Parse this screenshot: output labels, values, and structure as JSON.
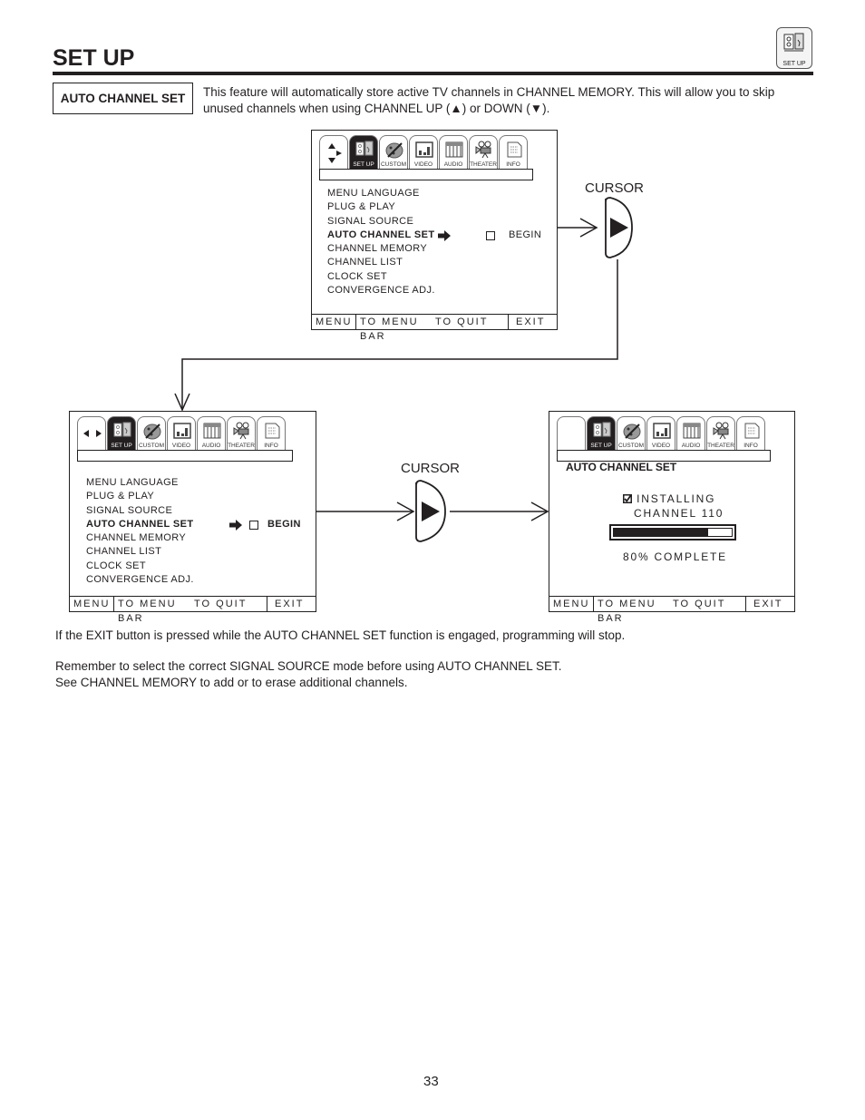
{
  "header": {
    "title": "SET UP",
    "corner_icon": {
      "icon": "setup-outlet-icon",
      "label": "SET UP"
    }
  },
  "feature": {
    "label": "AUTO CHANNEL SET",
    "description": "This feature will automatically store active TV channels in CHANNEL MEMORY.  This will allow you to skip unused channels when using CHANNEL UP (▲) or DOWN (▼)."
  },
  "tabs": [
    {
      "label": "SET UP",
      "icon": "setup-outlet-icon",
      "active": true
    },
    {
      "label": "CUSTOM",
      "icon": "palette-icon",
      "active": false
    },
    {
      "label": "VIDEO",
      "icon": "video-bars-icon",
      "active": false
    },
    {
      "label": "AUDIO",
      "icon": "piano-keys-icon",
      "active": false
    },
    {
      "label": "THEATER",
      "icon": "film-projector-icon",
      "active": false
    },
    {
      "label": "INFO",
      "icon": "info-document-icon",
      "active": false
    }
  ],
  "menu_items": [
    "MENU LANGUAGE",
    "PLUG & PLAY",
    "SIGNAL SOURCE",
    "AUTO CHANNEL SET",
    "CHANNEL MEMORY",
    "CHANNEL LIST",
    "CLOCK SET",
    "CONVERGENCE ADJ."
  ],
  "selected_item_index": 3,
  "begin_label": "BEGIN",
  "footer": {
    "menu": "MENU",
    "to_menu_bar": "TO MENU BAR",
    "to_quit": "TO QUIT",
    "exit": "EXIT"
  },
  "cursor_label": "CURSOR",
  "progress_screen": {
    "heading": "AUTO CHANNEL SET",
    "status": "INSTALLING",
    "channel": "CHANNEL 110",
    "progress_percent": 80,
    "progress_text": "80% COMPLETE"
  },
  "notes": [
    "If the EXIT button is pressed while the AUTO CHANNEL SET function is engaged, programming will stop.",
    "Remember to select the correct SIGNAL SOURCE mode before using AUTO CHANNEL SET.",
    "See CHANNEL MEMORY to add or to erase additional channels."
  ],
  "page_number": "33"
}
